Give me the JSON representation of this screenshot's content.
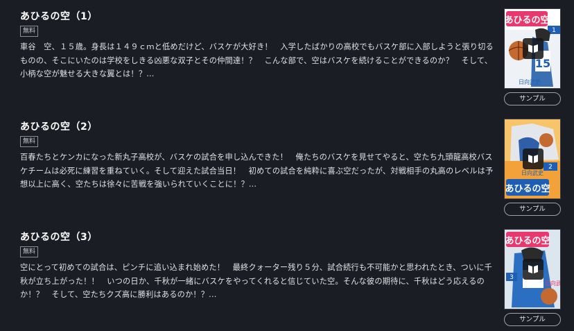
{
  "books": [
    {
      "title": "あひるの空（1）",
      "badge": "無料",
      "description": "車谷　空、１５歳。身長は１４９ｃｍと低めだけど、バスケが大好き！　入学したばかりの高校でもバスケ部に入部しようと張り切るものの、そこにいたのは学校をしきる凶悪な双子とその仲間達！？　こんな部で、空はバスケを続けることができるのか？　そして、小柄な空が魅せる大きな翼とは！？...",
      "sample_label": "サンプル",
      "cover_logo": "あひるの空",
      "cover_volume": "1",
      "cover_author": "日向武史",
      "cover_icon": "book-reader-icon"
    },
    {
      "title": "あひるの空（2）",
      "badge": "無料",
      "description": "百春たちとケンカになった新丸子高校が、バスケの試合を申し込んできた！　俺たちのバスケを見せてやると、空たち九頭龍高校バスケチームは必死に練習を重ねていく。そして迎えた試合当日！　初めての試合を純粋に喜ぶ空だったが、対戦相手の丸高のレベルは予想以上に高く、空たちは徐々に苦戦を強いられていくことに！？...",
      "sample_label": "サンプル",
      "cover_logo": "あひるの空",
      "cover_volume": "2",
      "cover_author": "日向武史",
      "cover_icon": "book-reader-icon"
    },
    {
      "title": "あひるの空（3）",
      "badge": "無料",
      "description": "空にとって初めての試合は、ピンチに追い込まれ始めた！　最終クォーター残り５分、試合続行も不可能かと思われたとき、ついに千秋が立ち上がった！！　いつの日か、千秋が一緒にバスケをやってくれると信じていた空。そんな彼の期待に、千秋はどう応えるのか！？　そして、空たちクズ高に勝利はあるのか！？...",
      "sample_label": "サンプル",
      "cover_logo": "あひるの空",
      "cover_volume": "3",
      "cover_author": "日向武史",
      "cover_icon": "book-reader-icon"
    }
  ],
  "colors": {
    "background": "#1b1d25",
    "cover1": "#e9eef3",
    "cover2": "#f3a23a",
    "cover3": "#2a6fc2",
    "logo_pink": "#e8386f",
    "logo_blue": "#1e5fb5"
  }
}
